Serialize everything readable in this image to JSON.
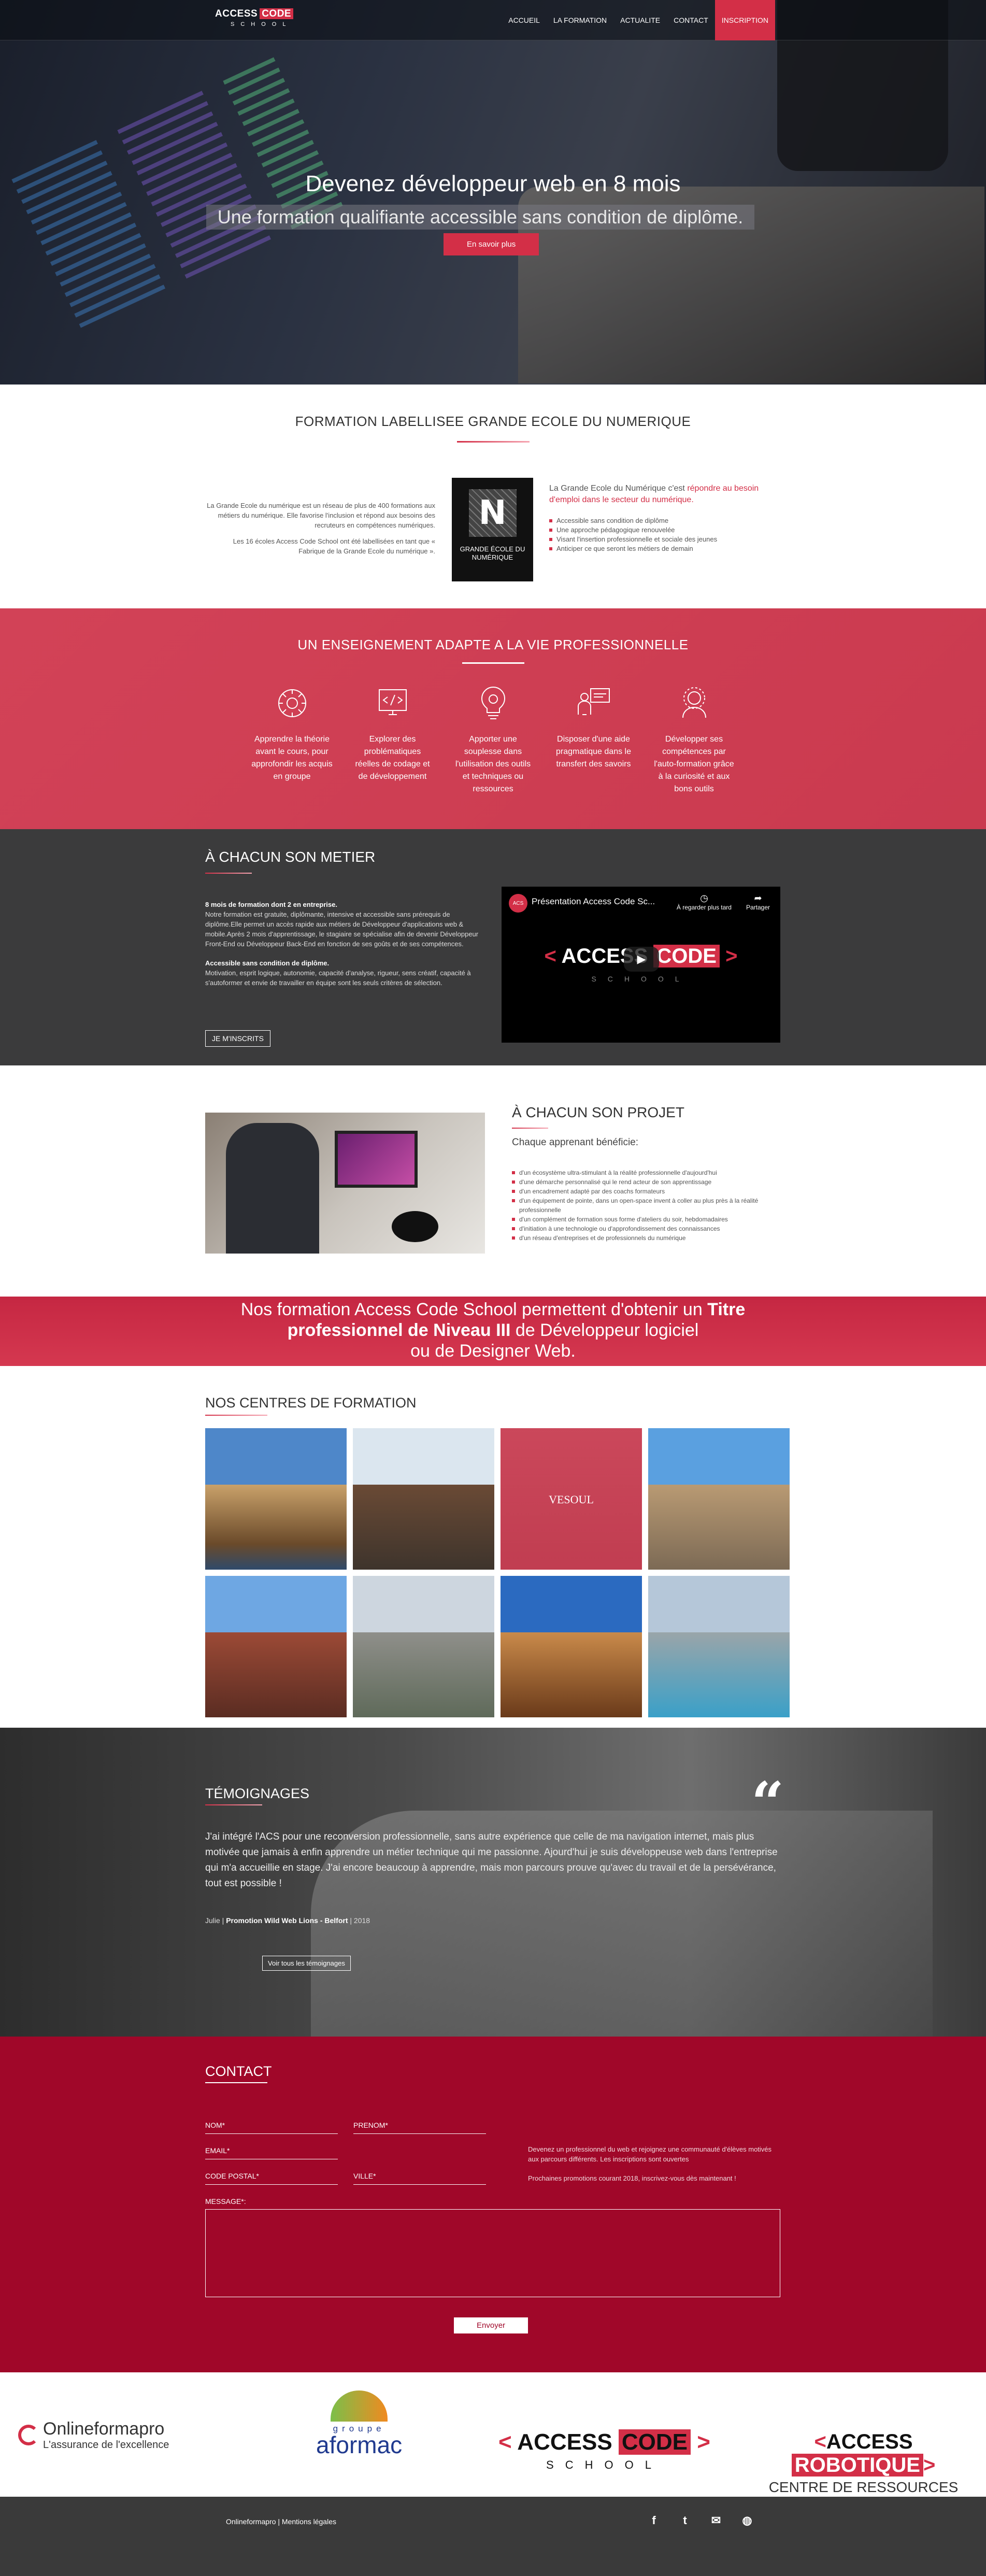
{
  "nav": {
    "logo_access": "ACCESS",
    "logo_code": "CODE",
    "logo_school": "SCHOOL",
    "items": [
      "ACCUEIL",
      "LA FORMATION",
      "ACTUALITE",
      "CONTACT",
      "INSCRIPTION"
    ]
  },
  "hero": {
    "title": "Devenez développeur web en 8 mois",
    "subtitle": "Une formation qualifiante accessible sans condition de diplôme.",
    "button": "En savoir plus"
  },
  "label_section": {
    "title": "FORMATION LABELLISEE GRANDE ECOLE DU NUMERIQUE",
    "left_p1": "La Grande Ecole du numérique est un réseau de plus de 400 formations aux métiers du numérique. Elle favorise l'inclusion et répond aux besoins des recruteurs en compétences numériques.",
    "left_p2": "Les 16 écoles Access Code School ont été labellisées en tant que « Fabrique de la Grande Ecole du numérique ».",
    "logo_letter": "N",
    "logo_text": "GRANDE ÉCOLE DU NUMÉRIQUE",
    "right_lead_1": "La Grande Ecole du Numérique c'est ",
    "right_lead_2": "répondre au besoin d'emploi dans le secteur du numérique.",
    "bullets": [
      "Accessible sans condition de diplôme",
      "Une approche pédagogique renouvelée",
      "Visant l'insertion professionnelle et sociale des jeunes",
      "Anticiper ce que seront les métiers de demain"
    ]
  },
  "pro_section": {
    "title": "UN ENSEIGNEMENT ADAPTE A LA VIE PROFESSIONNELLE",
    "items": [
      {
        "icon": "brain-gear-icon",
        "text": "Apprendre la théorie avant le cours, pour approfondir les acquis en groupe"
      },
      {
        "icon": "code-monitor-icon",
        "text": "Explorer des problématiques réelles de codage et de développement"
      },
      {
        "icon": "lightbulb-gear-icon",
        "text": "Apporter une souplesse dans l'utilisation des outils et techniques ou ressources"
      },
      {
        "icon": "teacher-board-icon",
        "text": "Disposer d'une aide pragmatique dans le transfert des savoirs"
      },
      {
        "icon": "person-gear-icon",
        "text": "Développer ses compétences par l'auto-formation grâce à la curiosité et aux bons outils"
      }
    ]
  },
  "metier": {
    "title": "À CHACUN SON METIER",
    "p1_bold": "8 mois de formation dont 2 en entreprise.",
    "p1": "Notre formation est gratuite, diplômante, intensive et accessible sans prérequis de diplôme.Elle permet un accès rapide aux métiers de Développeur d'applications web & mobile.Après 2 mois d'apprentissage, le stagiaire se spécialise afin de devenir Développeur Front-End ou Développeur Back-End en fonction de ses goûts et de ses compétences.",
    "p2_bold": "Accessible sans condition de diplôme.",
    "p2": "Motivation, esprit logique, autonomie, capacité d'analyse, rigueur, sens créatif, capacité à s'autoformer et envie de travailler en équipe sont les seuls critères de sélection.",
    "button": "JE M'INSCRITS",
    "video": {
      "channel": "ACS",
      "title": "Présentation Access Code Sc...",
      "watch_later": "À regarder plus tard",
      "share": "Partager",
      "logo_access": "ACCESS",
      "logo_code": "CODE",
      "logo_school": "SCHOOL"
    }
  },
  "projet": {
    "title": "À CHACUN SON PROJET",
    "lead": "Chaque apprenant bénéficie:",
    "bullets": [
      "d'un écosystème ultra-stimulant à la réalité professionnelle d'aujourd'hui",
      "d'une démarche personnalisé qui le rend acteur de son apprentissage",
      "d'un encadrement adapté par des coachs formateurs",
      "d'un équipement de pointe, dans un open-space invent à coller au plus près à la réalité professionnelle",
      "d'un complément de formation sous forme d'ateliers du soir, hebdomadaires",
      "d'initiation à une technologie ou d'approfondissement des connaissances",
      "d'un réseau d'entreprises et de professionnels du numérique"
    ]
  },
  "titre": {
    "line1": "Nos formation Access Code School permettent d'obtenir un ",
    "line1_bold": "Titre",
    "line2_bold": "professionnel de Niveau III",
    "line2": " de Développeur logiciel",
    "line3": "ou de Designer Web."
  },
  "centres": {
    "title": "NOS CENTRES DE FORMATION",
    "highlight_label": "VESOUL"
  },
  "temoignages": {
    "title": "TÉMOIGNAGES",
    "quote": "J'ai intégré l'ACS pour une reconversion professionnelle, sans autre expérience que celle de ma navigation internet, mais plus motivée que jamais à enfin apprendre un métier technique qui me passionne. Ajourd'hui je suis développeuse web dans l'entreprise qui m'a accueillie en stage. J'ai encore beaucoup à apprendre, mais mon parcours prouve qu'avec du travail et de la persévérance, tout est possible !",
    "author": "Julie",
    "promo": "Promotion Wild Web Lions - Belfort",
    "year": "2018",
    "button": "Voir tous les témoignages"
  },
  "contact": {
    "title": "CONTACT",
    "nom": "NOM*",
    "prenom": "PRENOM*",
    "email": "EMAIL*",
    "cp": "CODE POSTAL*",
    "ville": "VILLE*",
    "message": "MESSAGE*:",
    "side_p1": "Devenez un professionnel du web et rejoignez une communauté d'élèves motivés aux parcours différents. Les inscriptions sont ouvertes",
    "side_p2": "Prochaines promotions courant 2018, inscrivez-vous dès maintenant !",
    "send": "Envoyer"
  },
  "partners": {
    "ofm_name": "Onlineformapro",
    "ofm_tag": "L'assurance de l'excellence",
    "afor_g": "groupe",
    "afor_name": "aformac",
    "acs_access": "ACCESS",
    "acs_code": "CODE",
    "acs_school": "SCHOOL",
    "acr_access": "ACCESS",
    "acr_rob": "ROBOTIQUE",
    "acr_sub": "CENTRE DE RESSOURCES"
  },
  "footer": {
    "link1": "Onlineformapro",
    "sep": " | ",
    "link2": "Mentions légales",
    "social": [
      "facebook-icon",
      "twitter-icon",
      "mail-icon",
      "globe-icon"
    ]
  },
  "colors": {
    "accent": "#d32f47",
    "contact_bg": "#a00729",
    "dark_bg": "#3b3b3c"
  }
}
